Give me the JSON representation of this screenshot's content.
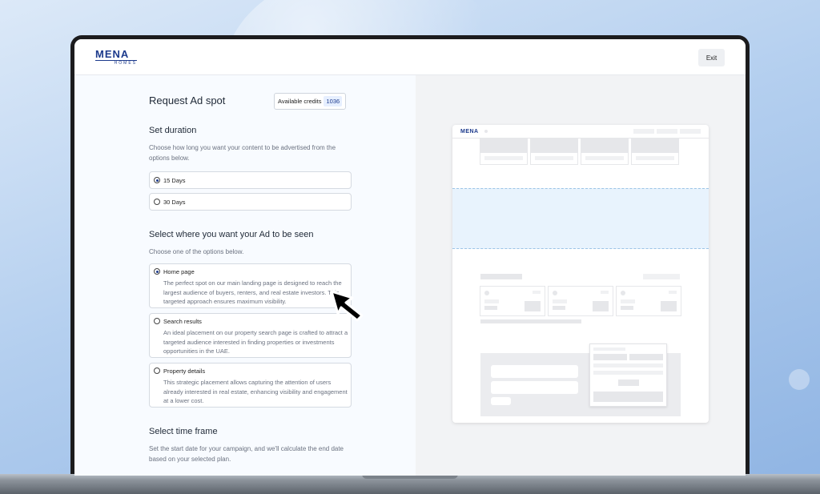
{
  "header": {
    "logo_main": "MENA",
    "logo_sub": "HOMES",
    "exit_label": "Exit"
  },
  "page": {
    "title": "Request Ad spot",
    "credits_label": "Available credits",
    "credits_value": "1036"
  },
  "duration": {
    "title": "Set duration",
    "description": "Choose how long you want your content to be advertised from the options below.",
    "options": [
      {
        "label": "15 Days",
        "selected": true
      },
      {
        "label": "30 Days",
        "selected": false
      }
    ]
  },
  "placement": {
    "title": "Select where you want your Ad to be seen",
    "description": "Choose one of the options below.",
    "options": [
      {
        "label": "Home page",
        "selected": true,
        "description": "The perfect spot on our main landing page is designed to reach the largest audience of buyers, renters, and real estate investors. This targeted approach ensures maximum visibility."
      },
      {
        "label": "Search results",
        "selected": false,
        "description": "An ideal placement on our property search page is crafted to attract a targeted audience interested in finding properties or investments opportunities in the UAE."
      },
      {
        "label": "Property details",
        "selected": false,
        "description": "This strategic placement allows capturing the attention of users already interested in real estate, enhancing visibility and engagement at a lower cost."
      }
    ]
  },
  "timeframe": {
    "title": "Select time frame",
    "description": "Set the start date for your campaign, and we'll calculate the end date based on your selected plan."
  },
  "preview": {
    "logo": "MENA"
  },
  "colors": {
    "brand": "#1c3a8c",
    "ad_zone": "#e8f3fd",
    "ad_zone_border": "#9cc4e6"
  },
  "icons": {
    "cursor": "arrow-cursor-icon",
    "radio_selected": "radio-selected-icon",
    "radio_unselected": "radio-unselected-icon"
  }
}
